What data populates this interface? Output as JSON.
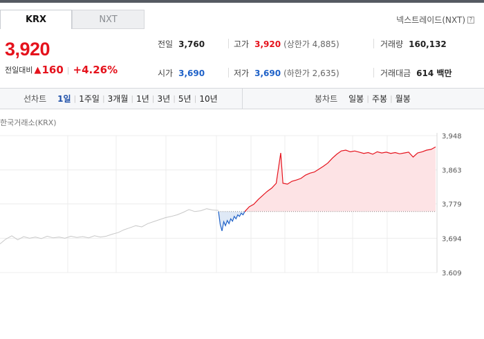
{
  "market_tabs": [
    {
      "label": "KRX",
      "active": true
    },
    {
      "label": "NXT",
      "active": false
    }
  ],
  "nxt_link": {
    "label": "넥스트레이드(NXT)",
    "help_glyph": "?"
  },
  "price": {
    "current": "3,920",
    "change_label": "전일대비",
    "change_arrow": "▲",
    "change_value": "160",
    "change_pct": "+4.26%"
  },
  "stats": {
    "prev_close": {
      "label": "전일",
      "value": "3,760"
    },
    "high": {
      "label": "고가",
      "value": "3,920",
      "sub": "(상한가 4,885)"
    },
    "volume": {
      "label": "거래량",
      "value": "160,132"
    },
    "open": {
      "label": "시가",
      "value": "3,690"
    },
    "low": {
      "label": "저가",
      "value": "3,690",
      "sub": "(하한가 2,635)"
    },
    "amount": {
      "label": "거래대금",
      "value": "614 백만"
    }
  },
  "chart_controls": {
    "line_title": "선차트",
    "line_periods": [
      "1일",
      "1주일",
      "3개월",
      "1년",
      "3년",
      "5년",
      "10년"
    ],
    "line_active_index": 0,
    "candle_title": "봉차트",
    "candle_periods": [
      "일봉",
      "주봉",
      "월봉"
    ]
  },
  "exchange_label": "한국거래소(KRX)",
  "colors": {
    "up": "#e5121c",
    "down": "#1e61c8",
    "prev_session": "#c8c8c8",
    "up_fill": "#fde3e5",
    "down_fill": "#dfe9f6"
  },
  "chart_data": {
    "type": "line",
    "title": "",
    "xlabel": "",
    "ylabel": "",
    "ylim": [
      3609,
      3948
    ],
    "y_ticks": [
      "3,948",
      "3,863",
      "3,779",
      "3,694",
      "3,609"
    ],
    "y_tick_values": [
      3948,
      3863,
      3779,
      3694,
      3609
    ],
    "baseline": 3760,
    "grid": true,
    "series": [
      {
        "segment": "previous_day",
        "points": [
          [
            0,
            3680
          ],
          [
            4,
            3692
          ],
          [
            8,
            3700
          ],
          [
            12,
            3690
          ],
          [
            16,
            3698
          ],
          [
            20,
            3694
          ],
          [
            24,
            3697
          ],
          [
            28,
            3693
          ],
          [
            32,
            3699
          ],
          [
            36,
            3695
          ],
          [
            40,
            3697
          ],
          [
            44,
            3694
          ],
          [
            48,
            3699
          ],
          [
            52,
            3696
          ],
          [
            56,
            3698
          ],
          [
            60,
            3695
          ],
          [
            64,
            3700
          ],
          [
            68,
            3697
          ],
          [
            72,
            3699
          ],
          [
            76,
            3704
          ],
          [
            80,
            3708
          ],
          [
            84,
            3715
          ],
          [
            88,
            3720
          ],
          [
            92,
            3725
          ],
          [
            96,
            3722
          ],
          [
            100,
            3730
          ],
          [
            104,
            3735
          ],
          [
            108,
            3740
          ],
          [
            112,
            3745
          ],
          [
            116,
            3748
          ],
          [
            120,
            3752
          ],
          [
            124,
            3758
          ],
          [
            128,
            3765
          ],
          [
            132,
            3760
          ],
          [
            136,
            3762
          ],
          [
            140,
            3767
          ],
          [
            144,
            3764
          ],
          [
            148,
            3763
          ]
        ]
      },
      {
        "segment": "today_below_prev",
        "points": [
          [
            0,
            3760
          ],
          [
            2,
            3728
          ],
          [
            4,
            3712
          ],
          [
            6,
            3735
          ],
          [
            8,
            3725
          ],
          [
            10,
            3738
          ],
          [
            12,
            3730
          ],
          [
            14,
            3742
          ],
          [
            16,
            3736
          ],
          [
            18,
            3748
          ],
          [
            20,
            3742
          ],
          [
            22,
            3752
          ],
          [
            24,
            3748
          ],
          [
            26,
            3756
          ],
          [
            28,
            3752
          ],
          [
            30,
            3760
          ]
        ]
      },
      {
        "segment": "today_above_prev",
        "points": [
          [
            30,
            3760
          ],
          [
            34,
            3772
          ],
          [
            38,
            3778
          ],
          [
            42,
            3790
          ],
          [
            46,
            3800
          ],
          [
            50,
            3810
          ],
          [
            54,
            3818
          ],
          [
            58,
            3830
          ],
          [
            62,
            3905
          ],
          [
            64,
            3830
          ],
          [
            68,
            3828
          ],
          [
            72,
            3835
          ],
          [
            76,
            3838
          ],
          [
            80,
            3842
          ],
          [
            84,
            3850
          ],
          [
            88,
            3855
          ],
          [
            92,
            3858
          ],
          [
            96,
            3865
          ],
          [
            100,
            3872
          ],
          [
            104,
            3880
          ],
          [
            108,
            3892
          ],
          [
            112,
            3902
          ],
          [
            116,
            3910
          ],
          [
            120,
            3912
          ],
          [
            124,
            3908
          ],
          [
            128,
            3910
          ],
          [
            132,
            3907
          ],
          [
            136,
            3904
          ],
          [
            140,
            3906
          ],
          [
            144,
            3902
          ],
          [
            148,
            3908
          ],
          [
            152,
            3905
          ],
          [
            156,
            3907
          ],
          [
            160,
            3904
          ],
          [
            164,
            3906
          ],
          [
            168,
            3903
          ],
          [
            172,
            3905
          ],
          [
            176,
            3907
          ],
          [
            180,
            3895
          ],
          [
            184,
            3905
          ],
          [
            188,
            3908
          ],
          [
            192,
            3912
          ],
          [
            196,
            3914
          ],
          [
            200,
            3920
          ]
        ]
      }
    ]
  }
}
